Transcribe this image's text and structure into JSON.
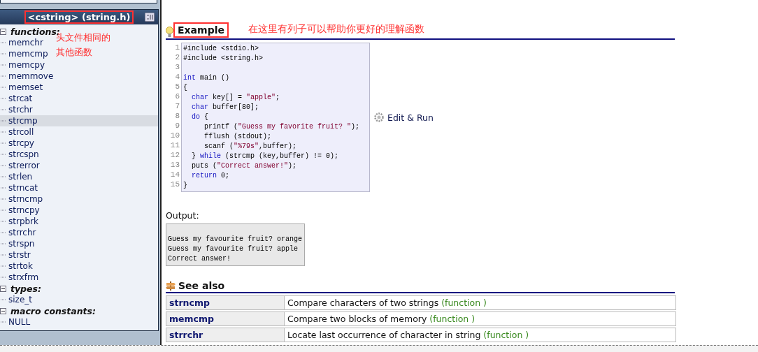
{
  "sidebar": {
    "header": {
      "title": "<cstring> (string.h)",
      "highlighted": true
    },
    "sections": [
      {
        "label": "functions:",
        "expanded": true,
        "children": [
          {
            "label": "memchr",
            "selected": false
          },
          {
            "label": "memcmp",
            "selected": false
          },
          {
            "label": "memcpy",
            "selected": false
          },
          {
            "label": "memmove",
            "selected": false
          },
          {
            "label": "memset",
            "selected": false
          },
          {
            "label": "strcat",
            "selected": false
          },
          {
            "label": "strchr",
            "selected": false
          },
          {
            "label": "strcmp",
            "selected": true
          },
          {
            "label": "strcoll",
            "selected": false
          },
          {
            "label": "strcpy",
            "selected": false
          },
          {
            "label": "strcspn",
            "selected": false
          },
          {
            "label": "strerror",
            "selected": false
          },
          {
            "label": "strlen",
            "selected": false
          },
          {
            "label": "strncat",
            "selected": false
          },
          {
            "label": "strncmp",
            "selected": false
          },
          {
            "label": "strncpy",
            "selected": false
          },
          {
            "label": "strpbrk",
            "selected": false
          },
          {
            "label": "strrchr",
            "selected": false
          },
          {
            "label": "strspn",
            "selected": false
          },
          {
            "label": "strstr",
            "selected": false
          },
          {
            "label": "strtok",
            "selected": false
          },
          {
            "label": "strxfrm",
            "selected": false
          }
        ]
      },
      {
        "label": "types:",
        "expanded": true,
        "children": [
          {
            "label": "size_t",
            "selected": false
          }
        ]
      },
      {
        "label": "macro constants:",
        "expanded": true,
        "children": [
          {
            "label": "NULL",
            "selected": false
          }
        ]
      }
    ],
    "annotation": [
      "头文件相同的",
      "其他函数"
    ]
  },
  "example": {
    "title": "Example",
    "highlighted": true,
    "annotation": "在这里有列子可以帮助你更好的理解函数",
    "code": [
      {
        "number": "1",
        "tokens": [
          {
            "kind": "plain",
            "text": "#include <stdio.h>"
          }
        ]
      },
      {
        "number": "2",
        "tokens": [
          {
            "kind": "plain",
            "text": "#include <string.h>"
          }
        ]
      },
      {
        "number": "3"
      },
      {
        "number": "4",
        "tokens": [
          {
            "kind": "keyword",
            "text": "int"
          },
          {
            "kind": "plain",
            "text": " main ()"
          }
        ]
      },
      {
        "number": "5",
        "tokens": [
          {
            "kind": "plain",
            "text": "{"
          }
        ]
      },
      {
        "number": "6",
        "tokens": [
          {
            "kind": "keyword",
            "text": "  char"
          },
          {
            "kind": "plain",
            "text": " key[] = "
          },
          {
            "kind": "string",
            "text": "\"apple\""
          },
          {
            "kind": "plain",
            "text": ";"
          }
        ]
      },
      {
        "number": "7",
        "tokens": [
          {
            "kind": "keyword",
            "text": "  char"
          },
          {
            "kind": "plain",
            "text": " buffer[80];"
          }
        ]
      },
      {
        "number": "8",
        "tokens": [
          {
            "kind": "keyword",
            "text": "  do"
          },
          {
            "kind": "plain",
            "text": " {"
          }
        ]
      },
      {
        "number": "9",
        "tokens": [
          {
            "kind": "plain",
            "text": "     printf ("
          },
          {
            "kind": "string",
            "text": "\"Guess my favorite fruit? \""
          },
          {
            "kind": "plain",
            "text": ");"
          }
        ]
      },
      {
        "number": "10",
        "tokens": [
          {
            "kind": "plain",
            "text": "     fflush (stdout);"
          }
        ]
      },
      {
        "number": "11",
        "tokens": [
          {
            "kind": "plain",
            "text": "     scanf ("
          },
          {
            "kind": "string",
            "text": "\"%79s\""
          },
          {
            "kind": "plain",
            "text": ",buffer);"
          }
        ]
      },
      {
        "number": "12",
        "tokens": [
          {
            "kind": "plain",
            "text": "  } "
          },
          {
            "kind": "keyword",
            "text": "while"
          },
          {
            "kind": "plain",
            "text": " (strcmp (key,buffer) != 0);"
          }
        ]
      },
      {
        "number": "13",
        "tokens": [
          {
            "kind": "plain",
            "text": "  puts ("
          },
          {
            "kind": "string",
            "text": "\"Correct answer!\""
          },
          {
            "kind": "plain",
            "text": ");"
          }
        ]
      },
      {
        "number": "14",
        "tokens": [
          {
            "kind": "keyword",
            "text": "  return"
          },
          {
            "kind": "plain",
            "text": " 0;"
          }
        ]
      },
      {
        "number": "15",
        "tokens": [
          {
            "kind": "plain",
            "text": "}"
          }
        ]
      }
    ],
    "run_link": "Edit & Run",
    "output_label": "Output:",
    "output_lines": [
      "Guess my favourite fruit? orange",
      "Guess my favourite fruit? apple",
      "Correct answer!"
    ]
  },
  "see_also": {
    "title": "See also",
    "rows": [
      {
        "name": "strncmp",
        "description": "Compare characters of two strings",
        "tag": "(function )"
      },
      {
        "name": "memcmp",
        "description": "Compare two blocks of memory",
        "tag": "(function )"
      },
      {
        "name": "strrchr",
        "description": "Locate last occurrence of character in string",
        "tag": "(function )"
      }
    ]
  }
}
